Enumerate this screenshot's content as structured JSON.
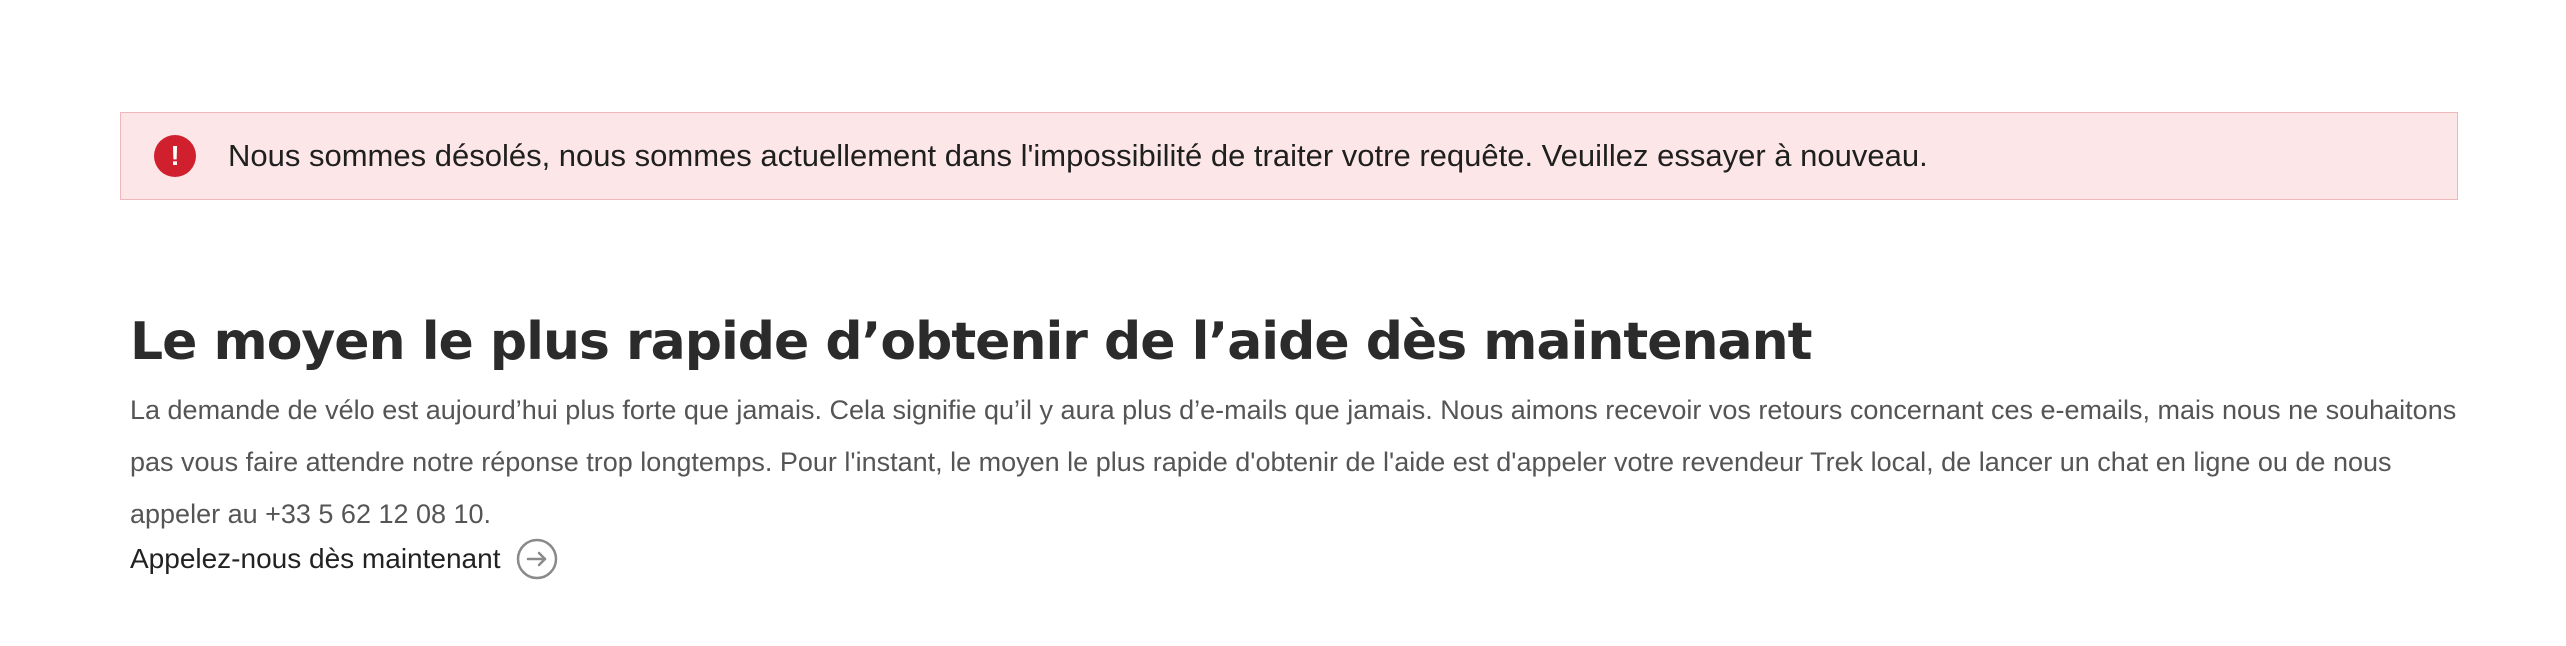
{
  "alert": {
    "icon": "exclamation-circle-icon",
    "icon_glyph": "!",
    "message": "Nous sommes désolés, nous sommes actuellement dans l'impossibilité de traiter votre requête. Veuillez essayer à nouveau.",
    "background_color": "#fce6e8",
    "border_color": "#f2b6bd",
    "icon_color": "#d0202e"
  },
  "section": {
    "heading": "Le moyen le plus rapide d’obtenir de l’aide dès maintenant",
    "body": "La demande de vélo est aujourd’hui plus forte que jamais. Cela signifie qu’il y aura plus d’e-mails que jamais. Nous aimons recevoir vos retours concernant ces e-emails, mais nous ne souhaitons pas vous faire attendre notre réponse trop longtemps. Pour l'instant, le moyen le plus rapide d'obtenir de l'aide est d'appeler votre revendeur Trek local, de lancer un chat en ligne ou de nous appeler au +33 5 62 12 08 10.",
    "cta_label": "Appelez-nous dès maintenant",
    "cta_icon": "arrow-right-circle-icon"
  }
}
